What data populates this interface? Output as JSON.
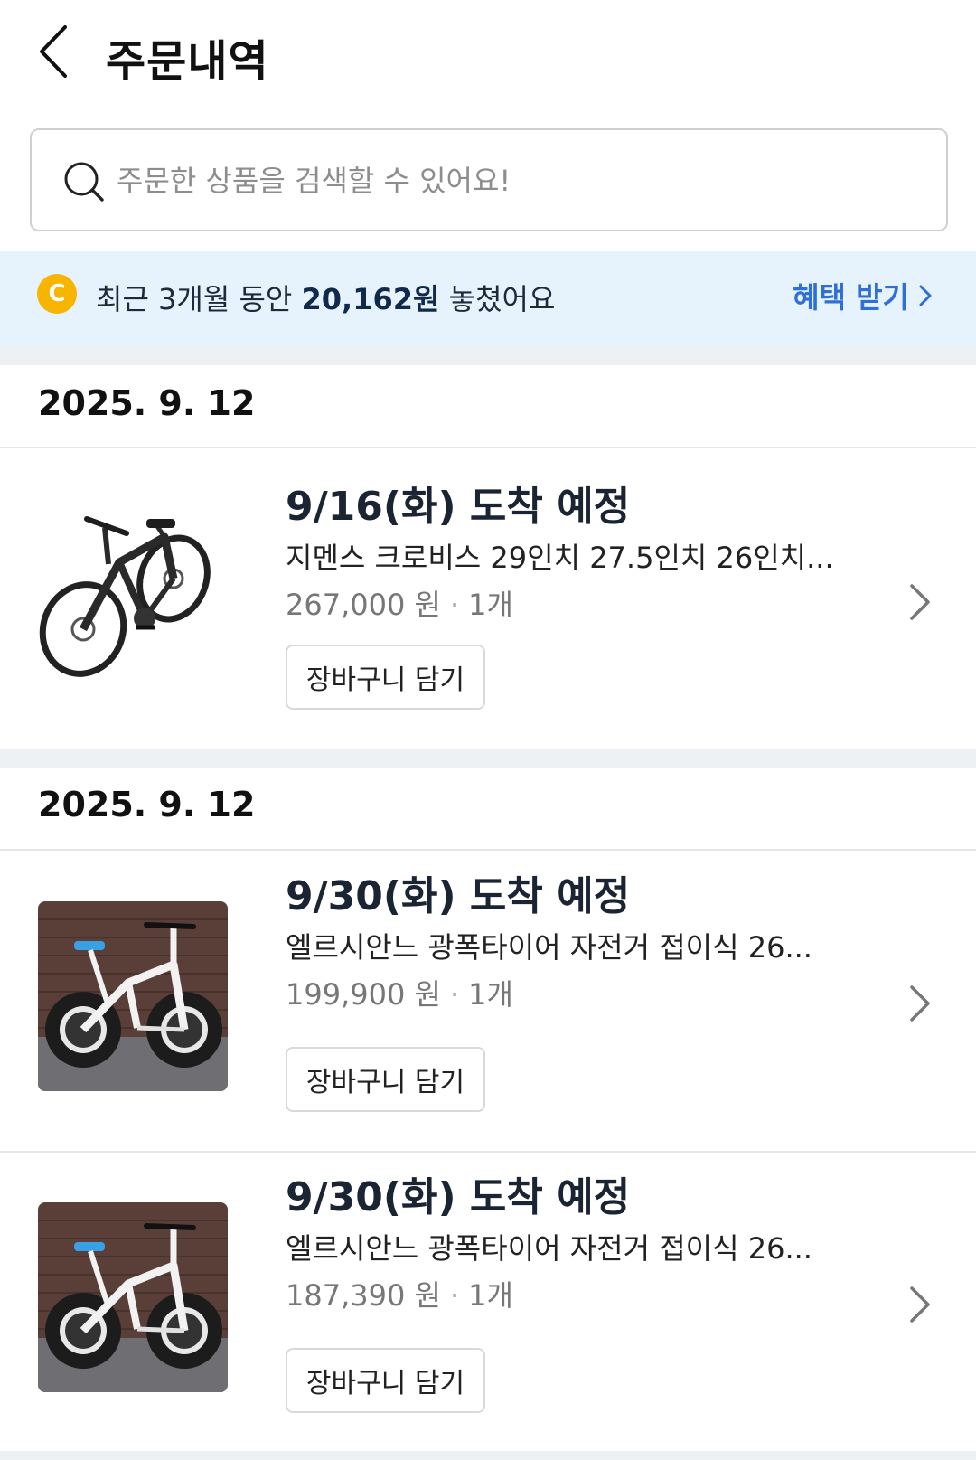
{
  "header": {
    "title": "주문내역",
    "back_icon": "chevron-left-icon"
  },
  "search": {
    "placeholder": "주문한 상품을 검색할 수 있어요!",
    "icon": "search-icon"
  },
  "savings_banner": {
    "coin_letter": "C",
    "text_before": "최근 3개월 동안 ",
    "amount": "20,162원",
    "text_after": " 놓쳤어요",
    "action_label": "혜택 받기",
    "action_color": "#2f6fd6",
    "background": "#e6f2fc"
  },
  "order_groups": [
    {
      "date": "2025. 9. 12",
      "items": [
        {
          "status": "9/16(화) 도착 예정",
          "name": "지멘스 크로비스 29인치 27.5인치 26인치...",
          "price": "267,000 원",
          "quantity": "1개",
          "cart_label": "장바구니 담기",
          "image": "black-full-suspension-mountain-bike"
        }
      ]
    },
    {
      "date": "2025. 9. 12",
      "items": [
        {
          "status": "9/30(화) 도착 예정",
          "name": "엘르시안느 광폭타이어 자전거 접이식 26...",
          "price": "199,900 원",
          "quantity": "1개",
          "cart_label": "장바구니 담기",
          "image": "white-fat-tire-folding-bike"
        },
        {
          "status": "9/30(화) 도착 예정",
          "name": "엘르시안느 광폭타이어 자전거 접이식 26...",
          "price": "187,390 원",
          "quantity": "1개",
          "cart_label": "장바구니 담기",
          "image": "white-fat-tire-folding-bike"
        }
      ]
    }
  ]
}
